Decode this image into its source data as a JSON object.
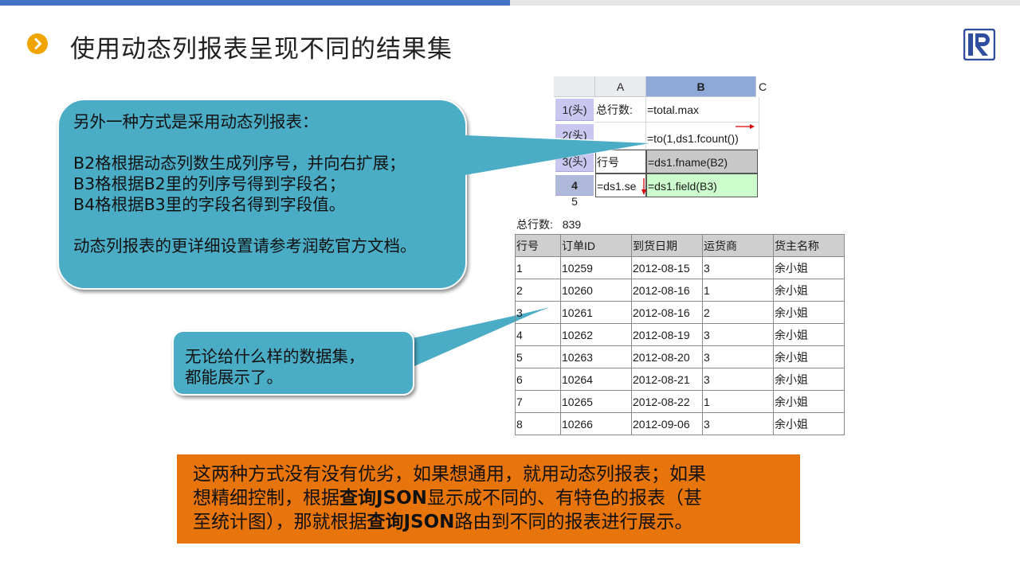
{
  "title": "使用动态列报表呈现不同的结果集",
  "icons": {
    "bullet": "chevron-right-icon",
    "logo": "brand-logo-icon"
  },
  "colors": {
    "accent": "#f0a400",
    "callout": "#4bacc6",
    "note": "#e8740c",
    "topbar": "#4472c4"
  },
  "callout1": {
    "lines": [
      "另外一种方式是采用动态列报表：",
      "B2格根据动态列数生成列序号，并向右扩展；",
      "B3格根据B2里的列序号得到字段名；",
      "B4格根据B3里的字段名得到字段值。",
      "动态列报表的更详细设置请参考润乾官方文档。"
    ]
  },
  "callout2": {
    "lines": [
      "无论给什么样的数据集，",
      "都能展示了。"
    ]
  },
  "designer": {
    "col_headers": [
      "A",
      "B",
      "C"
    ],
    "rows": [
      {
        "header": "1(头)",
        "a": "总行数:",
        "b": "=total.max"
      },
      {
        "header": "2(头)",
        "a": "",
        "b": "=to(1,ds1.fcount())"
      },
      {
        "header": "3(头)",
        "a": "行号",
        "b": "=ds1.fname(B2)"
      },
      {
        "header": "4",
        "a": "=ds1.se",
        "b": "=ds1.field(B3)"
      },
      {
        "header": "5",
        "a": "",
        "b": ""
      }
    ]
  },
  "result": {
    "total_label": "总行数:",
    "total_value": "839",
    "headers": [
      "行号",
      "订单ID",
      "到货日期",
      "运货商",
      "货主名称"
    ],
    "rows": [
      [
        "1",
        "10259",
        "2012-08-15",
        "3",
        "余小姐"
      ],
      [
        "2",
        "10260",
        "2012-08-16",
        "1",
        "余小姐"
      ],
      [
        "3",
        "10261",
        "2012-08-16",
        "2",
        "余小姐"
      ],
      [
        "4",
        "10262",
        "2012-08-19",
        "3",
        "余小姐"
      ],
      [
        "5",
        "10263",
        "2012-08-20",
        "3",
        "余小姐"
      ],
      [
        "6",
        "10264",
        "2012-08-21",
        "3",
        "余小姐"
      ],
      [
        "7",
        "10265",
        "2012-08-22",
        "1",
        "余小姐"
      ],
      [
        "8",
        "10266",
        "2012-09-06",
        "3",
        "余小姐"
      ],
      [
        "",
        "",
        "",
        "",
        ""
      ]
    ]
  },
  "note": {
    "l1": "这两种方式没有没有优劣，如果想通用，就用动态列报表；如果",
    "l2a": "想精细控制，根据",
    "l2b": "查询JSON",
    "l2c": "显示成不同的、有特色的报表（甚",
    "l3a": "至统计图），那就根据",
    "l3b": "查询JSON",
    "l3c": "路由到不同的报表进行展示。"
  }
}
